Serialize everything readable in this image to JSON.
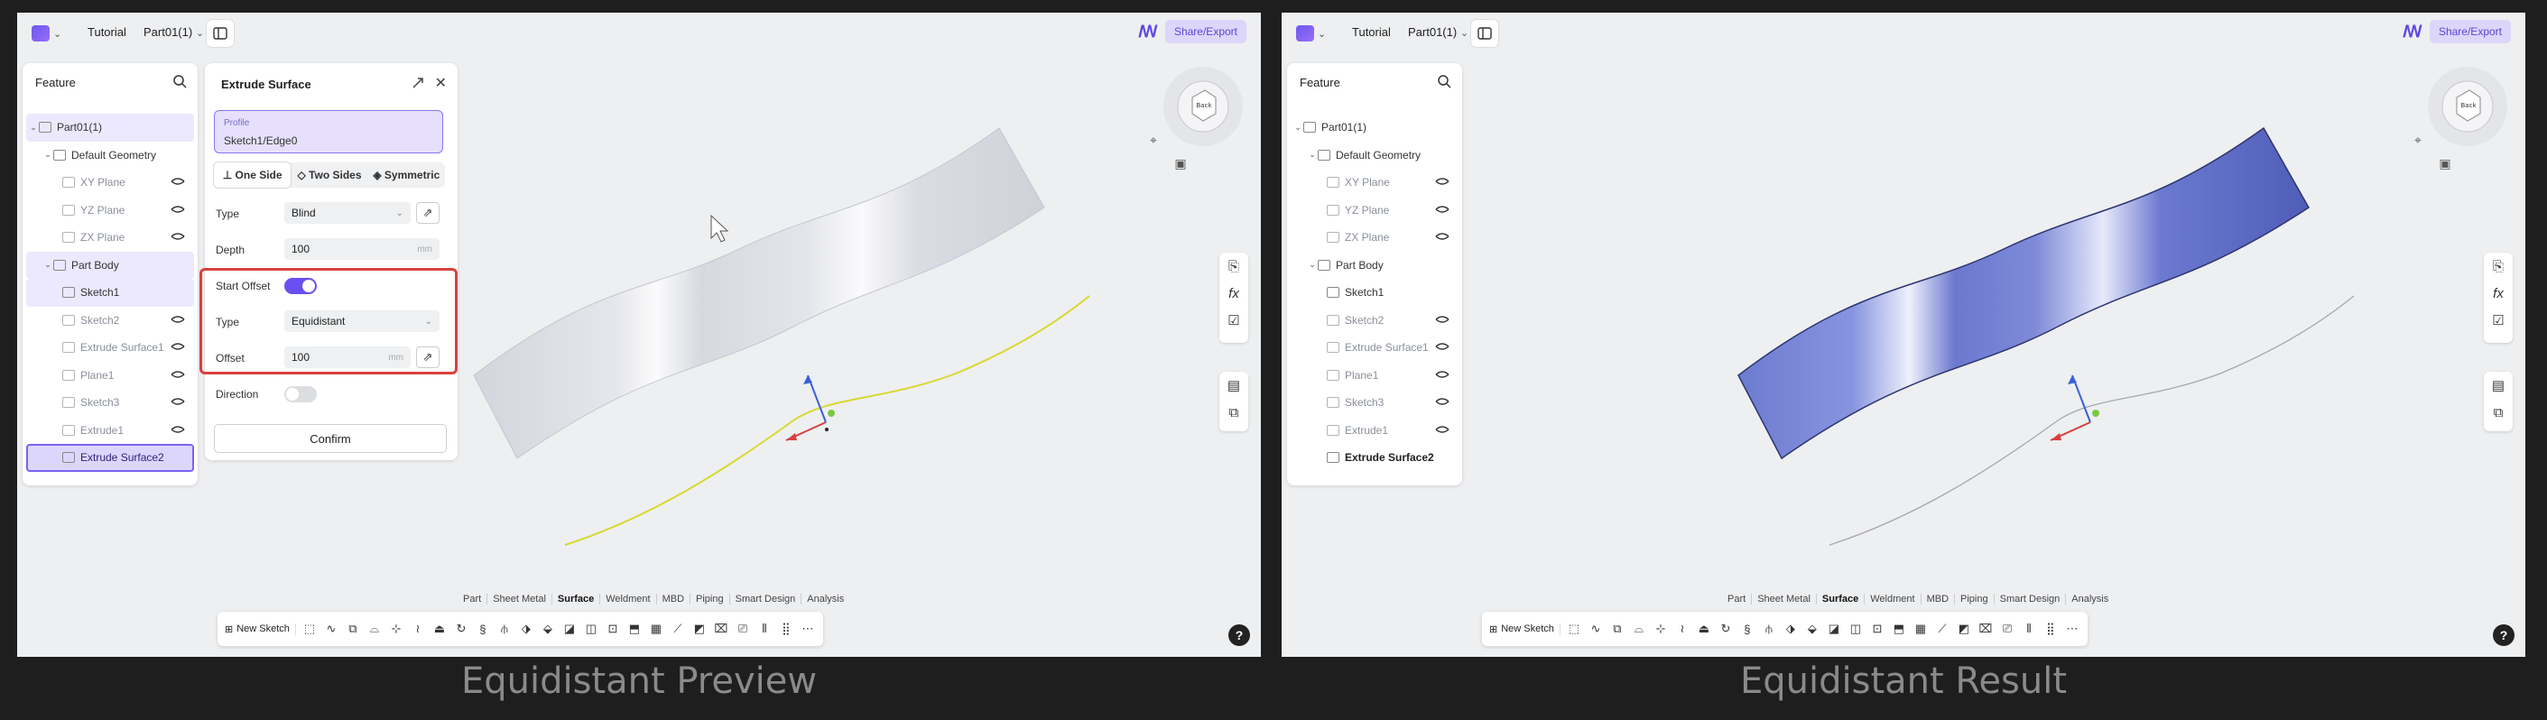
{
  "captions": {
    "left": "Equidistant Preview",
    "right": "Equidistant Result"
  },
  "topbar": {
    "crumb1": "Tutorial",
    "crumb2": "Part01(1)",
    "share_label": "Share/Export"
  },
  "feature_panel": {
    "title": "Feature",
    "items": [
      {
        "label": "Part01(1)"
      },
      {
        "label": "Default Geometry"
      },
      {
        "label": "XY Plane"
      },
      {
        "label": "YZ Plane"
      },
      {
        "label": "ZX Plane"
      },
      {
        "label": "Part Body"
      },
      {
        "label": "Sketch1"
      },
      {
        "label": "Sketch2"
      },
      {
        "label": "Extrude Surface1"
      },
      {
        "label": "Plane1"
      },
      {
        "label": "Sketch3"
      },
      {
        "label": "Extrude1"
      },
      {
        "label": "Extrude Surface2"
      }
    ]
  },
  "extrude_panel": {
    "title": "Extrude Surface",
    "profile_label": "Profile",
    "profile_value": "Sketch1/Edge0",
    "modes": [
      "One Side",
      "Two Sides",
      "Symmetric"
    ],
    "type_label": "Type",
    "type_value": "Blind",
    "depth_label": "Depth",
    "depth_value": "100",
    "depth_unit": "mm",
    "start_offset_label": "Start Offset",
    "start_offset_on": true,
    "offset_type_label": "Type",
    "offset_type_value": "Equidistant",
    "offset_label": "Offset",
    "offset_value": "100",
    "offset_unit": "mm",
    "direction_label": "Direction",
    "direction_on": false,
    "confirm_label": "Confirm"
  },
  "view_cube": {
    "face_label": "Back"
  },
  "bottom_tabs": [
    "Part",
    "Sheet Metal",
    "Surface",
    "Weldment",
    "MBD",
    "Piping",
    "Smart Design",
    "Analysis"
  ],
  "active_tab": "Surface",
  "toolbar": {
    "new_sketch_label": "New Sketch"
  },
  "help_label": "?",
  "colors": {
    "accent": "#6a4ff0",
    "highlight_box": "#d9413d",
    "preview_curve": "#d8d830",
    "result_surface": "#6f7fd6"
  },
  "icons": [
    "search-icon",
    "pin-icon",
    "close-icon",
    "eye-icon",
    "sketch-icon",
    "body-icon",
    "fx-icon",
    "help-icon"
  ]
}
